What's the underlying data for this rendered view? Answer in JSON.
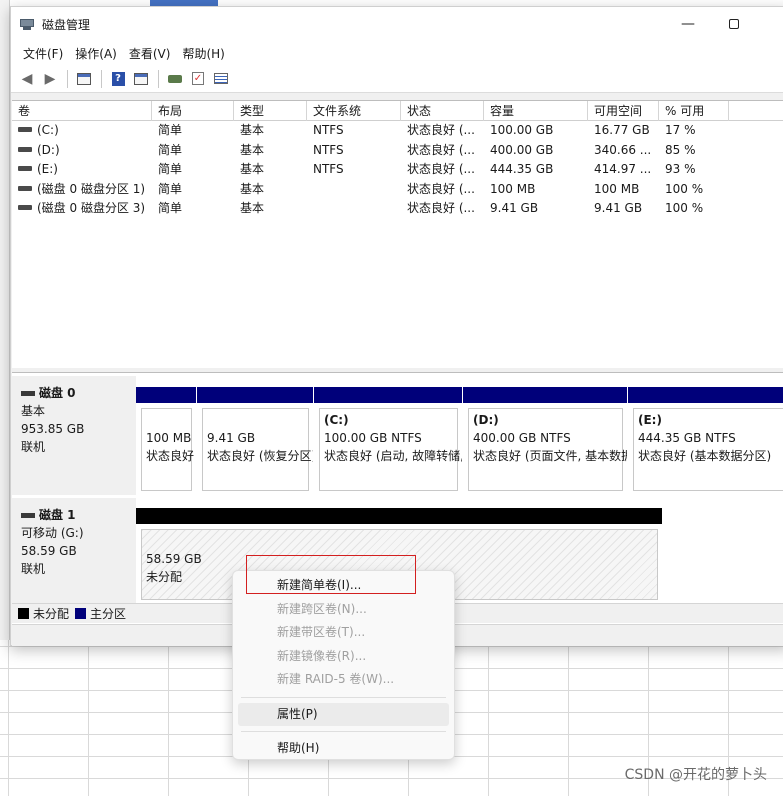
{
  "window": {
    "title": "磁盘管理",
    "minimize_glyph": "—"
  },
  "menu": [
    "文件(F)",
    "操作(A)",
    "查看(V)",
    "帮助(H)"
  ],
  "toolbar_icons": [
    "back-arrow-icon",
    "forward-arrow-icon",
    "console-icon",
    "help-icon",
    "list-view-icon",
    "connect-icon",
    "check-icon",
    "properties-icon"
  ],
  "volume_table": {
    "headers": [
      "卷",
      "布局",
      "类型",
      "文件系统",
      "状态",
      "容量",
      "可用空间",
      "% 可用",
      ""
    ],
    "rows": [
      [
        "(C:)",
        "简单",
        "基本",
        "NTFS",
        "状态良好 (...",
        "100.00 GB",
        "16.77 GB",
        "17 %"
      ],
      [
        "(D:)",
        "简单",
        "基本",
        "NTFS",
        "状态良好 (...",
        "400.00 GB",
        "340.66 ...",
        "85 %"
      ],
      [
        "(E:)",
        "简单",
        "基本",
        "NTFS",
        "状态良好 (...",
        "444.35 GB",
        "414.97 ...",
        "93 %"
      ],
      [
        "(磁盘 0 磁盘分区 1)",
        "简单",
        "基本",
        "",
        "状态良好 (...",
        "100 MB",
        "100 MB",
        "100 %"
      ],
      [
        "(磁盘 0 磁盘分区 3)",
        "简单",
        "基本",
        "",
        "状态良好 (...",
        "9.41 GB",
        "9.41 GB",
        "100 %"
      ]
    ]
  },
  "disk0": {
    "name": "磁盘 0",
    "type": "基本",
    "size": "953.85 GB",
    "state": "联机",
    "partitions": [
      {
        "title": "",
        "size": "100 MB",
        "status": "状态良好"
      },
      {
        "title": "",
        "size": "9.41 GB",
        "status": "状态良好 (恢复分区)"
      },
      {
        "title": "(C:)",
        "size": "100.00 GB NTFS",
        "status": "状态良好 (启动, 故障转储, 基本数据分区)"
      },
      {
        "title": "(D:)",
        "size": "400.00 GB NTFS",
        "status": "状态良好 (页面文件, 基本数据分区)"
      },
      {
        "title": "(E:)",
        "size": "444.35 GB NTFS",
        "status": "状态良好 (基本数据分区)"
      }
    ]
  },
  "disk1": {
    "name": "磁盘 1",
    "type": "可移动 (G:)",
    "size": "58.59 GB",
    "state": "联机",
    "partition": {
      "size": "58.59 GB",
      "status": "未分配"
    }
  },
  "legend": {
    "unallocated": "未分配",
    "primary": "主分区"
  },
  "colors": {
    "primary": "#00007a",
    "unallocated": "#000000",
    "highlight": "#d32020"
  },
  "context_menu": {
    "items": [
      {
        "label": "新建简单卷(I)...",
        "enabled": true
      },
      {
        "label": "新建跨区卷(N)...",
        "enabled": false
      },
      {
        "label": "新建带区卷(T)...",
        "enabled": false
      },
      {
        "label": "新建镜像卷(R)...",
        "enabled": false
      },
      {
        "label": "新建 RAID-5 卷(W)...",
        "enabled": false
      }
    ],
    "properties": "属性(P)",
    "help": "帮助(H)"
  },
  "watermark": "CSDN @开花的萝卜头"
}
